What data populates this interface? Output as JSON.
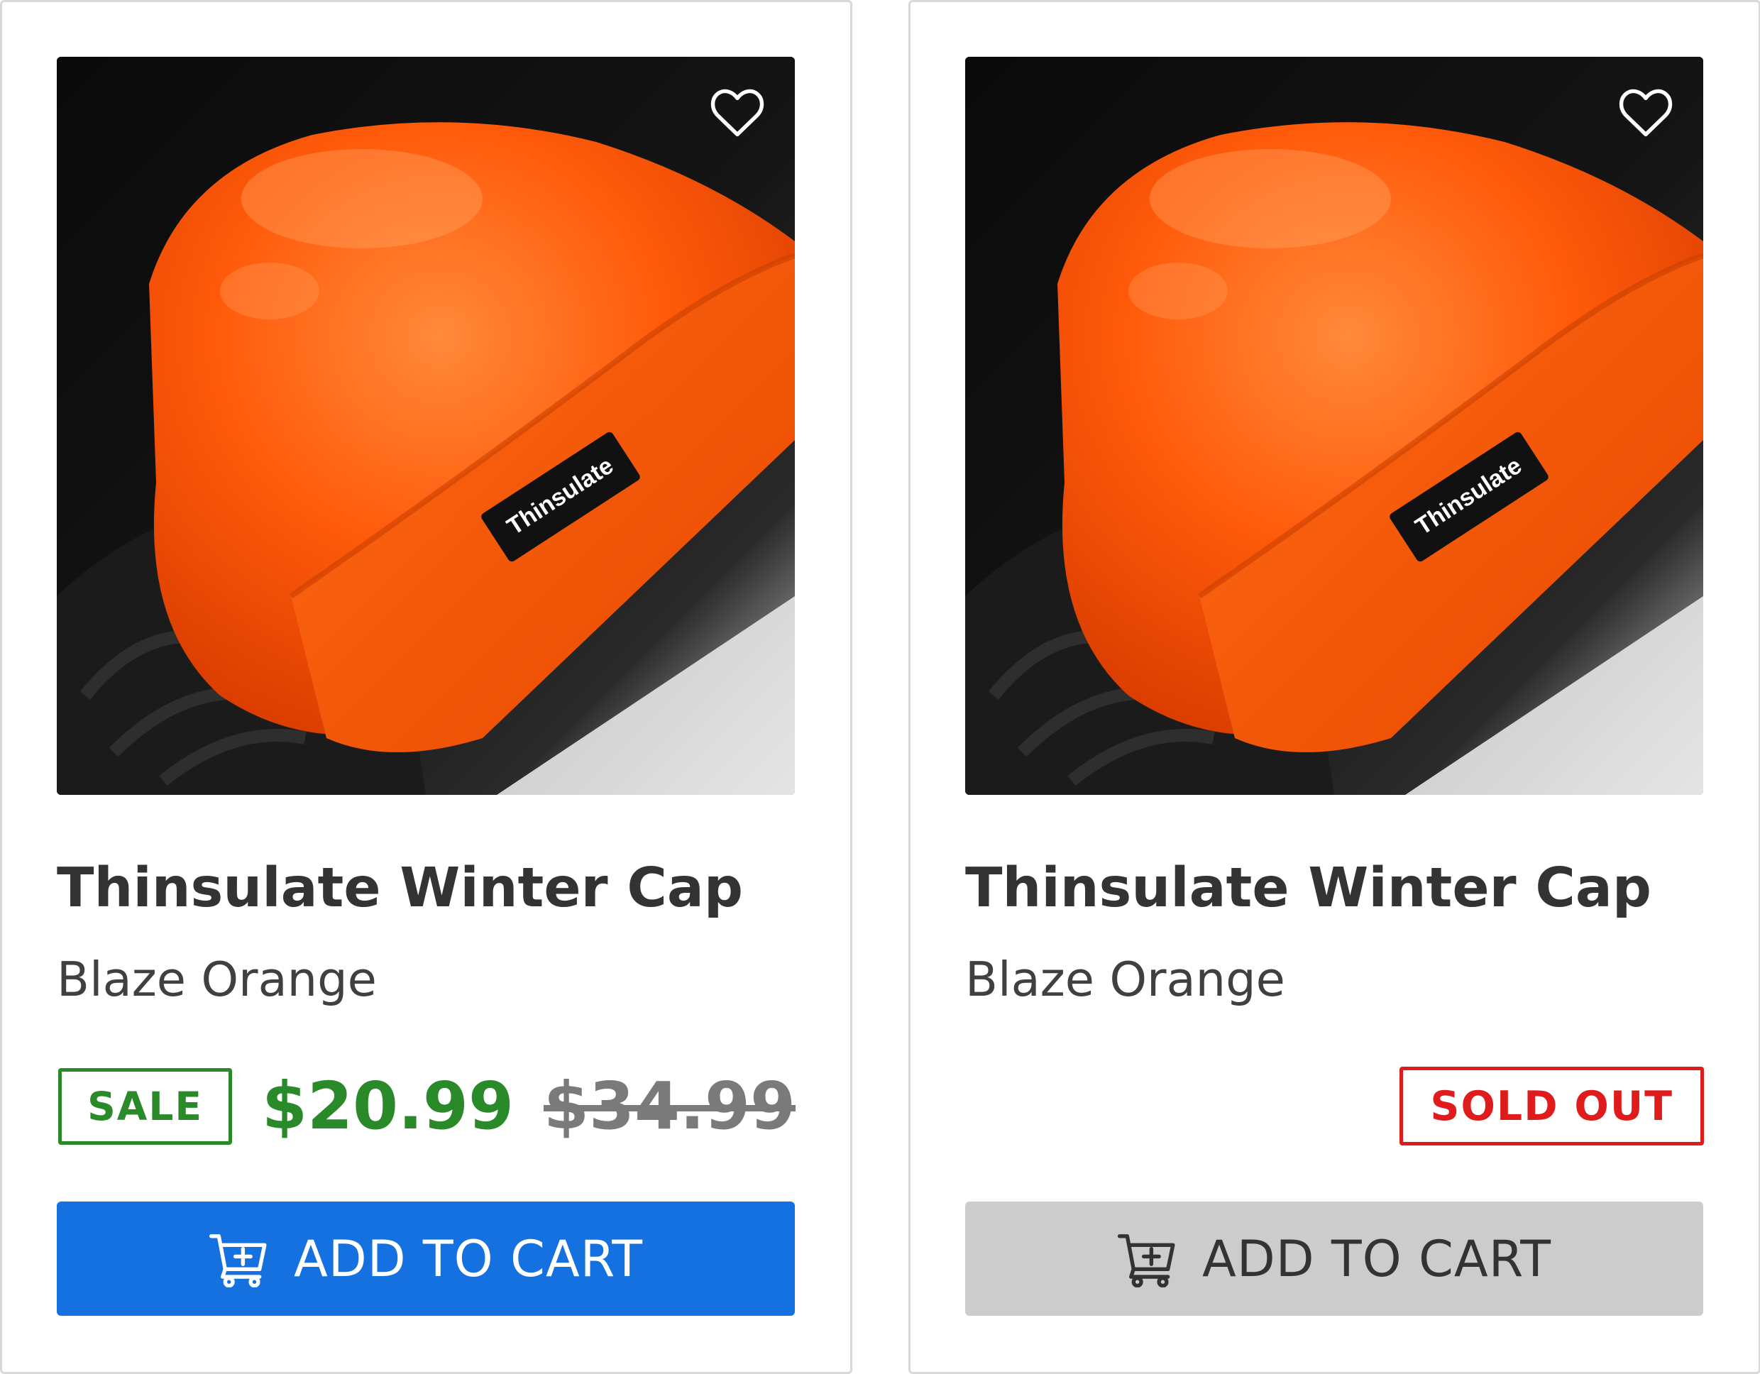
{
  "products": [
    {
      "title": "Thinsulate Winter Cap",
      "variant": "Blaze Orange",
      "sale_badge": "SALE",
      "price": "$20.99",
      "original_price": "$34.99",
      "add_to_cart_label": "ADD TO CART",
      "label_brand": "Thinsulate",
      "icons": [
        "heart-outline-icon",
        "cart-plus-icon"
      ]
    },
    {
      "title": "Thinsulate Winter Cap",
      "variant": "Blaze Orange",
      "status_badge": "SOLD OUT",
      "add_to_cart_label": "ADD TO CART",
      "label_brand": "Thinsulate",
      "icons": [
        "heart-outline-icon",
        "cart-plus-icon"
      ]
    }
  ],
  "colors": {
    "sale_green": "#2a8a2a",
    "sold_out_red": "#e01b1b",
    "cart_blue": "#1570e0",
    "cart_disabled_gray": "#cccccc",
    "hat_orange": "#ff5a0a"
  }
}
